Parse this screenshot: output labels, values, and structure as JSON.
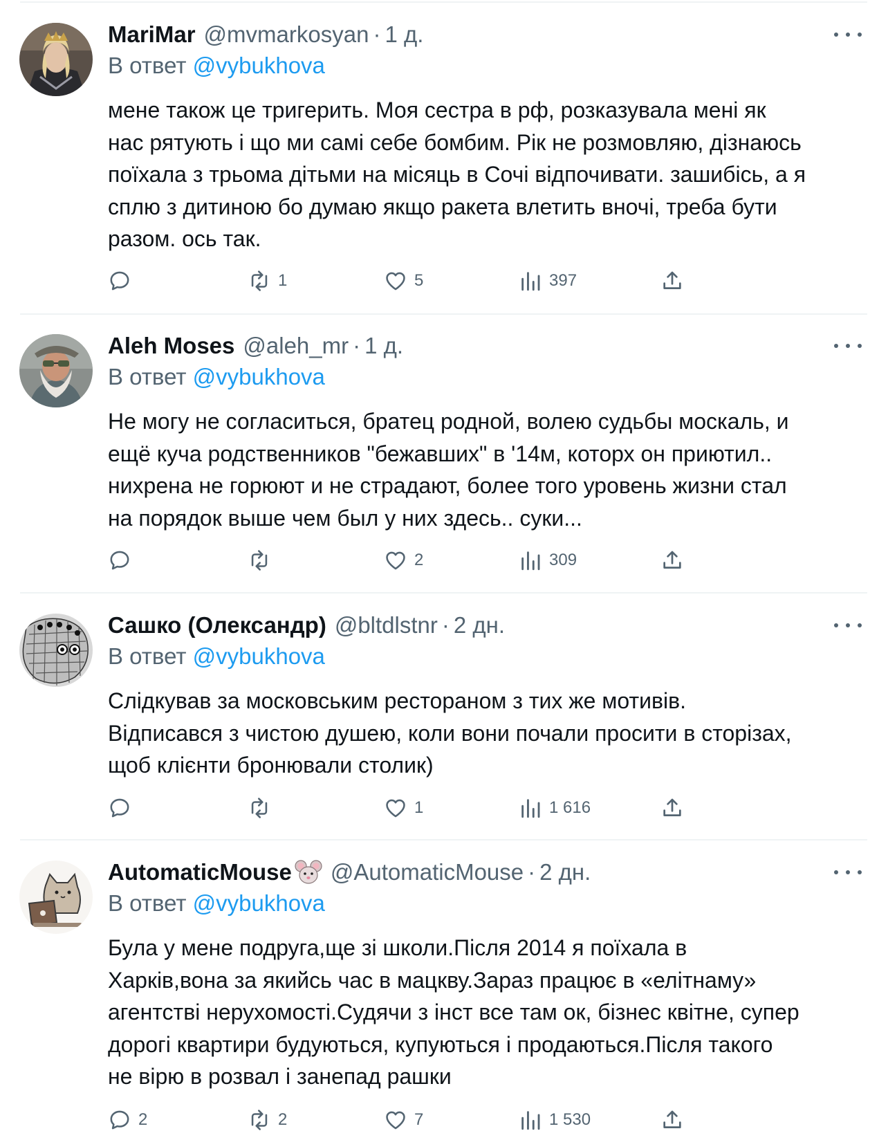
{
  "tweets": [
    {
      "name": "MariMar",
      "handle": "@mvmarkosyan",
      "time": "1 д.",
      "reply_prefix": "В ответ",
      "reply_to": "@vybukhova",
      "text_lines": [
        "мене також це тригерить. Моя сестра в рф, розказувала мені як",
        "нас рятують і що ми самі себе бомбим. Рік не розмовляю, дізнаюсь",
        "поїхала з трьома дітьми на місяць в Сочі відпочивати. зашибісь, а я",
        "сплю з дитиною бо думаю якщо ракета влетить вночі, треба бути",
        "разом. ось так."
      ],
      "replies": "",
      "retweets": "1",
      "likes": "5",
      "views": "397",
      "avatar_icon": "portrait-woman-crown-icon"
    },
    {
      "name": "Aleh Moses",
      "handle": "@aleh_mr",
      "time": "1 д.",
      "reply_prefix": "В ответ",
      "reply_to": "@vybukhova",
      "text_lines": [
        "Не могу не согласиться, братец родной, волею судьбы москаль, и",
        "ещё куча родственников \"бежавших\" в '14м, которх он приютил..",
        "нихрена не горюют и не страдают, более того уровень жизни стал",
        "на порядок выше чем был у них здесь.. суки..."
      ],
      "replies": "",
      "retweets": "",
      "likes": "2",
      "views": "309",
      "avatar_icon": "bearded-man-cap-icon"
    },
    {
      "name": "Сашко (Олександр)",
      "handle": "@bltdlstnr",
      "time": "2 дн.",
      "reply_prefix": "В ответ",
      "reply_to": "@vybukhova",
      "text_lines": [
        "Слідкував за московським рестораном з тих же мотивів.",
        "Відписався з чистою душею, коли вони почали просити в сторізах,",
        "щоб клієнти бронювали столик)"
      ],
      "replies": "",
      "retweets": "",
      "likes": "1",
      "views": "1 616",
      "avatar_icon": "sketch-doodle-icon"
    },
    {
      "name": "AutomaticMouse",
      "name_emoji": "mouse-face-icon",
      "handle": "@AutomaticMouse",
      "time": "2 дн.",
      "reply_prefix": "В ответ",
      "reply_to": "@vybukhova",
      "text_lines": [
        "Була у мене подруга,ще зі школи.Після 2014 я поїхала в",
        "Харків,вона за якийсь час в мацкву.Зараз працює в «елітнаму»",
        "агентстві нерухомості.Судячи з інст все там ок, бізнес квітне, супер",
        "дорогі квартири будуються, купуються і продаються.Після такого",
        "не вірю в розвал і занепад рашки"
      ],
      "replies": "2",
      "retweets": "2",
      "likes": "7",
      "views": "1 530",
      "avatar_icon": "cat-laptop-icon"
    }
  ],
  "colors": {
    "text": "#0f1419",
    "secondary": "#536471",
    "link": "#1d9bf0",
    "divider": "#eff3f4"
  }
}
